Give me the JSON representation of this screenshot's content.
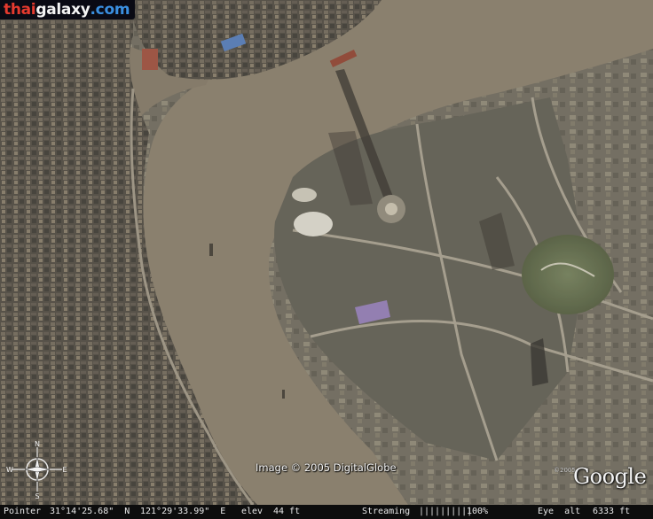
{
  "watermark": {
    "part1": "thai",
    "part2": "galaxy",
    "part3": ".com"
  },
  "imagery_credit": "Image © 2005 DigitalGlobe",
  "logo": {
    "year": "©2005",
    "name": "Google"
  },
  "compass": {
    "n": "N",
    "s": "S",
    "e": "E",
    "w": "W"
  },
  "status_bar": {
    "pointer_label": "Pointer",
    "latitude": "31°14'25.68\"  N",
    "longitude": "121°29'33.99\"  E",
    "elev_label": "elev",
    "elev_value": "44 ft",
    "streaming_label": "Streaming",
    "streaming_bars": "||||||||||",
    "streaming_percent": "100%",
    "eye_alt_label": "Eye  alt",
    "eye_alt_value": "6333 ft"
  },
  "colors": {
    "river": "#857a68",
    "urban": "#4e4a42",
    "status_bar": "#0d0d0d"
  }
}
